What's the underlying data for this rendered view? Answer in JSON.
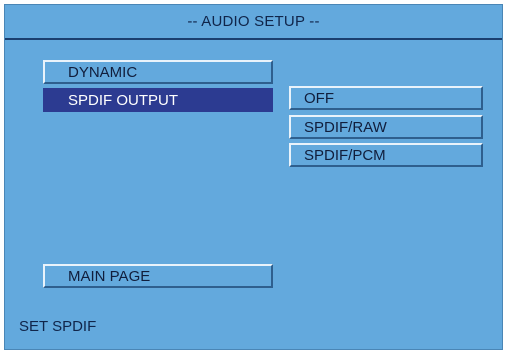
{
  "header": {
    "title": "-- AUDIO SETUP --"
  },
  "menu": {
    "items": [
      {
        "label": "DYNAMIC",
        "selected": false
      },
      {
        "label": "SPDIF OUTPUT",
        "selected": true
      }
    ],
    "main_page_label": "MAIN PAGE"
  },
  "submenu": {
    "options": [
      {
        "label": "OFF"
      },
      {
        "label": "SPDIF/RAW"
      },
      {
        "label": "SPDIF/PCM"
      }
    ]
  },
  "status": {
    "text": "SET SPDIF"
  },
  "colors": {
    "background": "#63a9dd",
    "selected": "#2c3b91",
    "text": "#111e3c"
  }
}
